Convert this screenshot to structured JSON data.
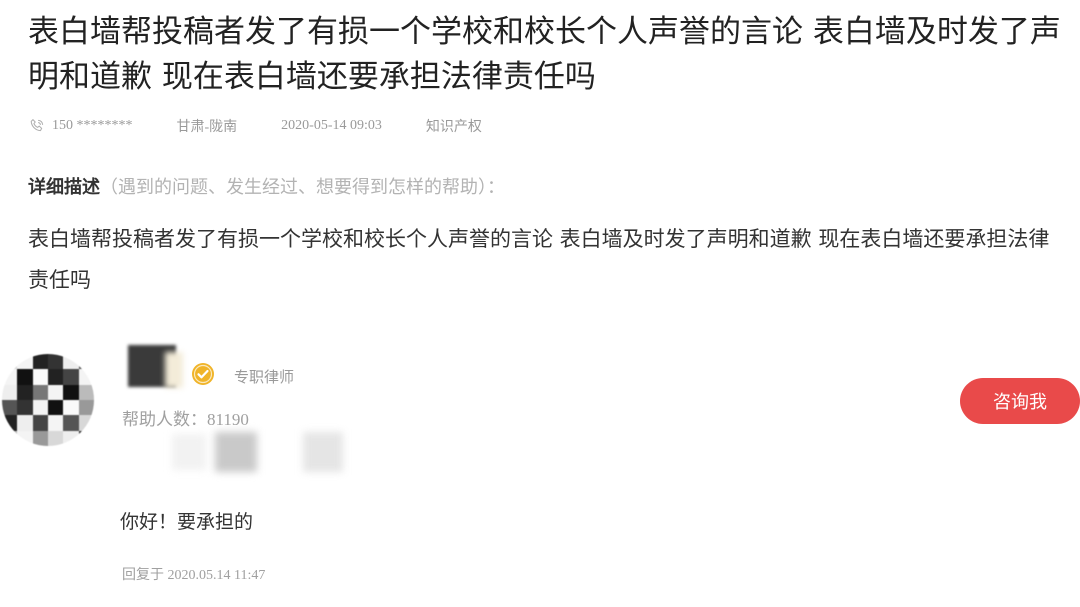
{
  "question": {
    "title": "表白墙帮投稿者发了有损一个学校和校长个人声誉的言论 表白墙及时发了声明和道歉 现在表白墙还要承担法律责任吗",
    "meta": {
      "phone": "150 ********",
      "location": "甘肃-陇南",
      "datetime": "2020-05-14 09:03",
      "category": "知识产权"
    },
    "description_label": "详细描述",
    "description_hint": "（遇到的问题、发生经过、想要得到怎样的帮助）：",
    "description_body": "表白墙帮投稿者发了有损一个学校和校长个人声誉的言论 表白墙及时发了声明和道歉 现在表白墙还要承担法律责任吗"
  },
  "answer": {
    "role": "专职律师",
    "help_count": "帮助人数：81190",
    "consult_button": "咨询我",
    "text": "你好！要承担的",
    "reply_time": "回复于 2020.05.14 11:47"
  },
  "icons": {
    "phone": "phone-icon",
    "verified": "verified-badge-icon"
  },
  "colors": {
    "accent": "#e94a4a",
    "verified": "#f0b429",
    "muted": "#9a9a9a"
  }
}
